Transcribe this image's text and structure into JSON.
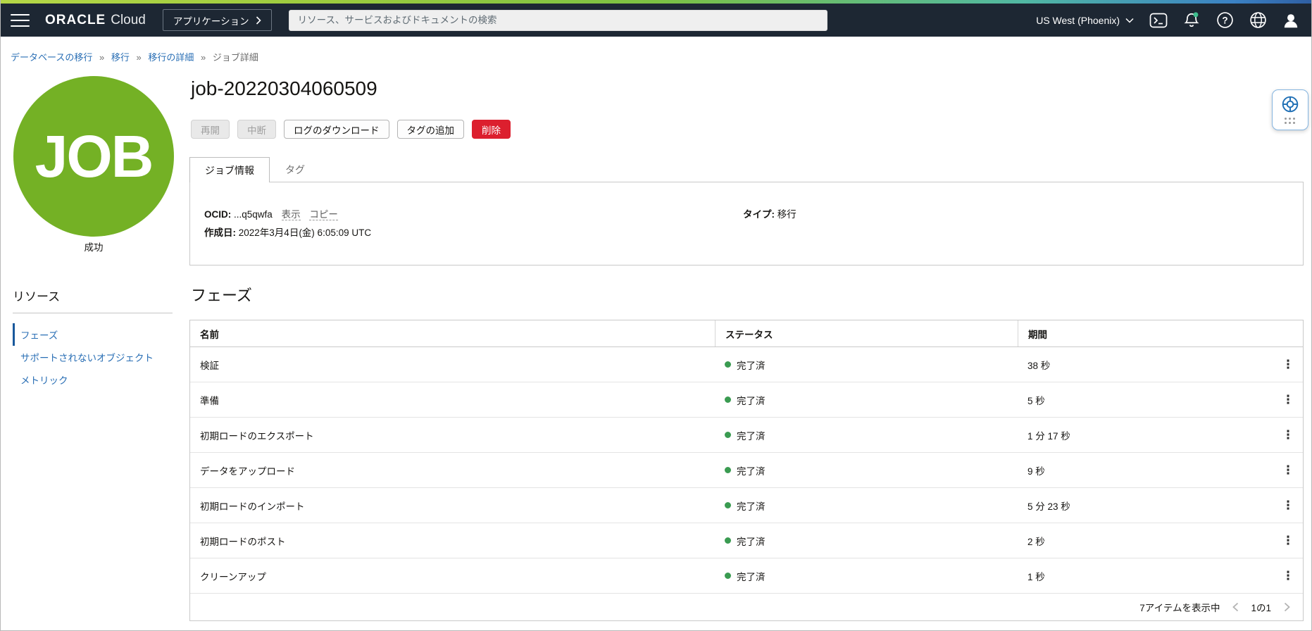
{
  "topbar": {
    "brand": {
      "oracle": "ORACLE",
      "cloud": "Cloud"
    },
    "apps_button_label": "アプリケーション",
    "search_placeholder": "リソース、サービスおよびドキュメントの検索",
    "region": "US West (Phoenix)",
    "help_glyph": "?"
  },
  "breadcrumb": {
    "items": [
      "データベースの移行",
      "移行",
      "移行の詳細"
    ],
    "separator": "»",
    "current": "ジョブ詳細"
  },
  "sidebar": {
    "badge_text": "JOB",
    "status_text": "成功",
    "resources_title": "リソース",
    "items": [
      {
        "label": "フェーズ",
        "active": true
      },
      {
        "label": "サポートされないオブジェクト",
        "active": false
      },
      {
        "label": "メトリック",
        "active": false
      }
    ]
  },
  "page": {
    "title": "job-20220304060509",
    "actions": [
      {
        "label": "再開",
        "state": "disabled"
      },
      {
        "label": "中断",
        "state": "disabled"
      },
      {
        "label": "ログのダウンロード",
        "state": "default"
      },
      {
        "label": "タグの追加",
        "state": "default"
      },
      {
        "label": "削除",
        "state": "danger"
      }
    ],
    "tabs": [
      {
        "label": "ジョブ情報",
        "active": true
      },
      {
        "label": "タグ",
        "active": false
      }
    ],
    "details": {
      "ocid_label": "OCID:",
      "ocid_value": "...q5qwfa",
      "show_link": "表示",
      "copy_link": "コピー",
      "created_label": "作成日:",
      "created_value": "2022年3月4日(金) 6:05:09 UTC",
      "type_label": "タイプ:",
      "type_value": "移行"
    },
    "phases": {
      "title": "フェーズ",
      "columns": [
        "名前",
        "ステータス",
        "期間"
      ],
      "rows": [
        {
          "name": "検証",
          "status": "完了済",
          "duration": "38 秒"
        },
        {
          "name": "準備",
          "status": "完了済",
          "duration": "5 秒"
        },
        {
          "name": "初期ロードのエクスポート",
          "status": "完了済",
          "duration": "1 分 17 秒"
        },
        {
          "name": "データをアップロード",
          "status": "完了済",
          "duration": "9 秒"
        },
        {
          "name": "初期ロードのインポート",
          "status": "完了済",
          "duration": "5 分 23 秒"
        },
        {
          "name": "初期ロードのポスト",
          "status": "完了済",
          "duration": "2 秒"
        },
        {
          "name": "クリーンアップ",
          "status": "完了済",
          "duration": "1 秒"
        }
      ],
      "footer": {
        "count_text": "7アイテムを表示中",
        "page_text": "1の1"
      }
    }
  },
  "icons": {
    "kebab": "⋮"
  },
  "colors": {
    "top_accent_green": "#8cc63f",
    "topbar_bg": "#1d2733",
    "job_badge_green": "#74b125",
    "link_blue": "#2a6fb5",
    "status_green": "#3a9b51",
    "danger_red": "#dc1f2e"
  }
}
